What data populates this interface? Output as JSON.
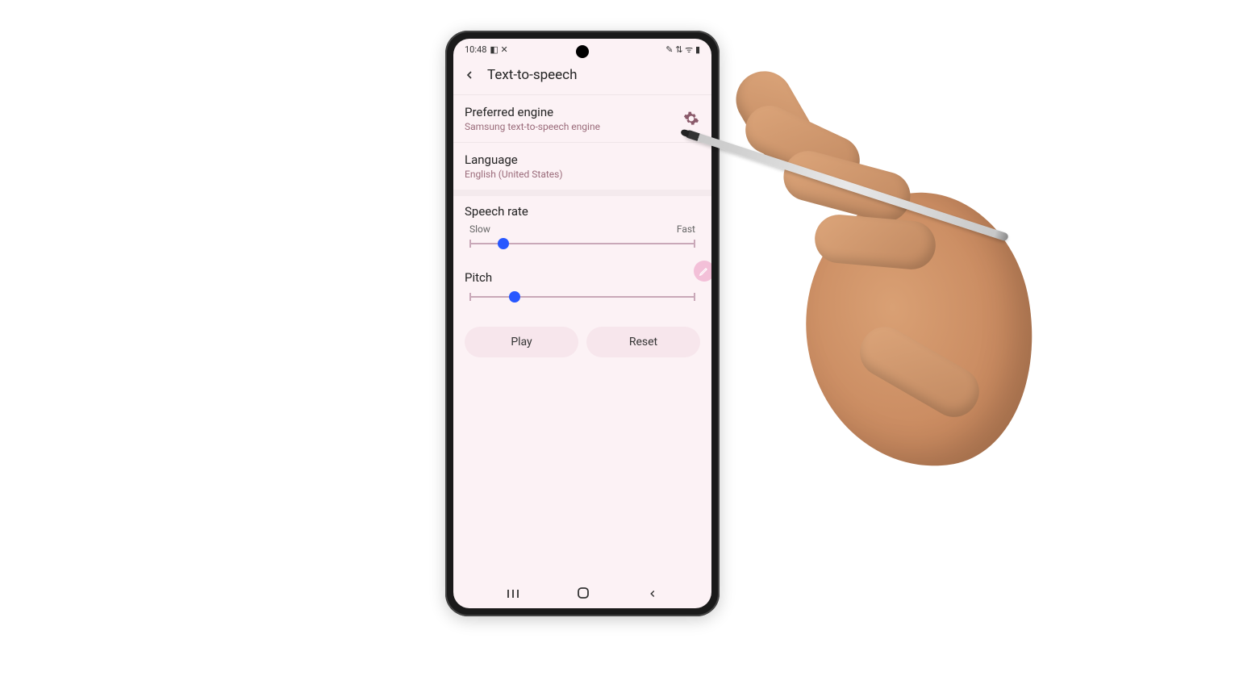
{
  "status": {
    "time": "10:48",
    "left_icons": "◧ ✕",
    "right_icons": "✎ ⇅ ᯤ ▮"
  },
  "header": {
    "title": "Text-to-speech"
  },
  "rows": {
    "engine": {
      "title": "Preferred engine",
      "sub": "Samsung text-to-speech engine"
    },
    "language": {
      "title": "Language",
      "sub": "English (United States)"
    }
  },
  "sliders": {
    "speech_rate": {
      "title": "Speech rate",
      "slow": "Slow",
      "fast": "Fast",
      "value_pct": 15
    },
    "pitch": {
      "title": "Pitch",
      "value_pct": 20
    }
  },
  "buttons": {
    "play": "Play",
    "reset": "Reset"
  },
  "colors": {
    "accent": "#2757ff",
    "tint": "#fcf2f5",
    "pill": "#f7e6ec"
  }
}
